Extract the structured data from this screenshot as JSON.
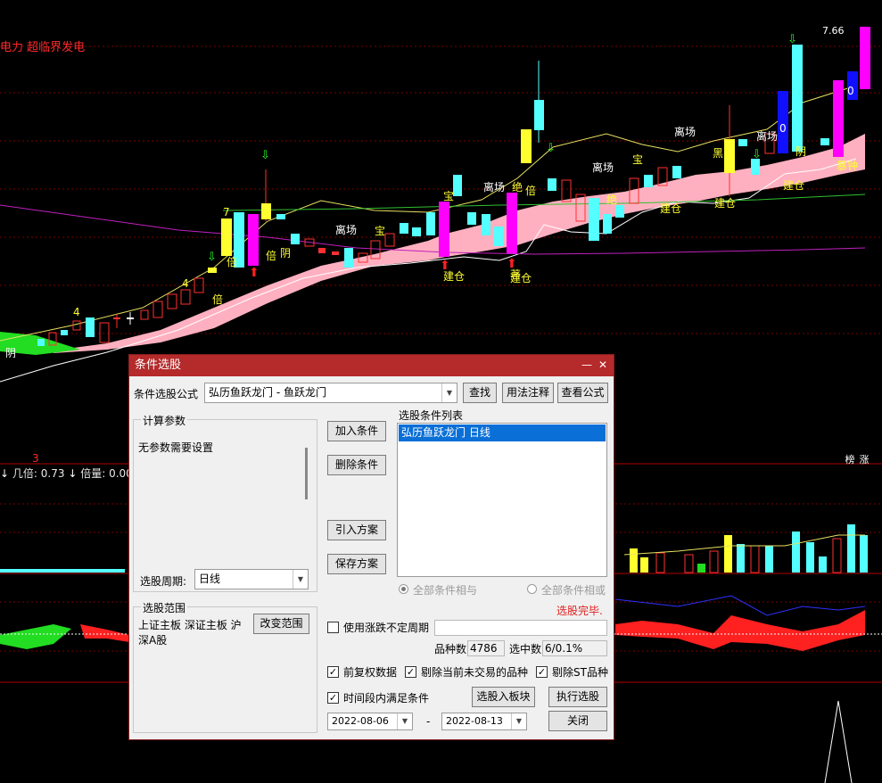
{
  "stock": {
    "title": "电力 超临界发电"
  },
  "indicator": {
    "arrow": "↓",
    "label1": "几倍:",
    "value1": "0.73",
    "label2": "倍量:",
    "value2": "0.00",
    "marker": "3"
  },
  "price_label": "7.66",
  "badges": [
    "榜",
    "涨"
  ],
  "dialog": {
    "title": "条件选股",
    "formula_label": "条件选股公式",
    "formula_value": "弘历鱼跃龙门 - 鱼跃龙门",
    "btn_find": "查找",
    "btn_usage": "用法注释",
    "btn_view": "查看公式",
    "params_group": "计算参数",
    "params_text": "无参数需要设置",
    "period_label": "选股周期:",
    "period_value": "日线",
    "btn_add": "加入条件",
    "btn_delete": "删除条件",
    "btn_import": "引入方案",
    "btn_save": "保存方案",
    "list_title": "选股条件列表",
    "list_items": [
      "弘历鱼跃龙门  日线"
    ],
    "radio_and": "全部条件相与",
    "radio_or": "全部条件相或",
    "status": "选股完毕.",
    "range_group": "选股范围",
    "range_text1": "上证主板 深证主板 沪",
    "range_text2": "深A股",
    "btn_change_range": "改变范围",
    "use_period_label": "使用涨跌不定周期",
    "count_label": "品种数",
    "count_value": "4786",
    "selected_label": "选中数",
    "selected_value": "6/0.1%",
    "cb_fq": "前复权数据",
    "cb_exclude_untraded": "剔除当前未交易的品种",
    "cb_exclude_st": "剔除ST品种",
    "cb_period": "时间段内满足条件",
    "btn_to_block": "选股入板块",
    "btn_execute": "执行选股",
    "date_from": "2022-08-06",
    "date_sep": "-",
    "date_to": "2022-08-13",
    "btn_close": "关闭"
  },
  "colors": {
    "up": "#ff3030",
    "down": "#54ffff",
    "accent": "#ff00ff",
    "band": "#ffb0c0",
    "dialog_title": "#b52a2a"
  },
  "chart_labels": [
    {
      "text": "离场"
    },
    {
      "text": "离场"
    },
    {
      "text": "离场"
    },
    {
      "text": "离场"
    },
    {
      "text": "离场"
    },
    {
      "text": "建仓"
    },
    {
      "text": "建仓"
    },
    {
      "text": "建仓"
    },
    {
      "text": "建仓"
    },
    {
      "text": "建仓"
    },
    {
      "text": "倍"
    },
    {
      "text": "倍"
    },
    {
      "text": "倍"
    },
    {
      "text": "倍"
    },
    {
      "text": "宝"
    },
    {
      "text": "宝"
    },
    {
      "text": "宝"
    },
    {
      "text": "阴"
    },
    {
      "text": "阴"
    },
    {
      "text": "阴"
    },
    {
      "text": "绝"
    },
    {
      "text": "绝"
    },
    {
      "text": "黑"
    },
    {
      "text": "著"
    },
    {
      "text": "暴钟"
    },
    {
      "text": "4"
    },
    {
      "text": "4"
    },
    {
      "text": "7"
    },
    {
      "text": "0"
    },
    {
      "text": "0"
    }
  ]
}
